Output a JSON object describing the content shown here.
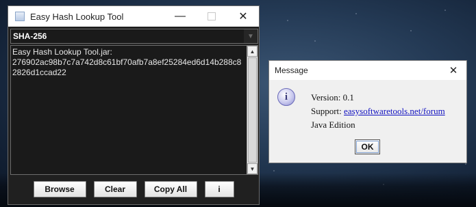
{
  "main_window": {
    "title": "Easy Hash Lookup Tool",
    "minimize_glyph": "—",
    "close_glyph": "✕",
    "hash_type": "SHA-256",
    "dropdown_arrow": "▼",
    "output_text": "Easy Hash Lookup Tool.jar:\n276902ac98b7c7a742d8c61bf70afb7a8ef25284ed6d14b288c82826d1ccad22",
    "scroll_up": "▲",
    "scroll_down": "▼",
    "buttons": {
      "browse": "Browse",
      "clear": "Clear",
      "copy_all": "Copy All",
      "info": "i"
    }
  },
  "message_dialog": {
    "title": "Message",
    "close_glyph": "✕",
    "icon_glyph": "i",
    "version_line": "Version: 0.1",
    "support_label": "Support: ",
    "support_link": "easysoftwaretools.net/forum",
    "edition_line": "Java Edition",
    "ok_label": "OK"
  },
  "colors": {
    "window_bg": "#202020",
    "field_bg": "#1a1a1a",
    "dialog_bg": "#f0f0f0",
    "link": "#1010c0"
  }
}
